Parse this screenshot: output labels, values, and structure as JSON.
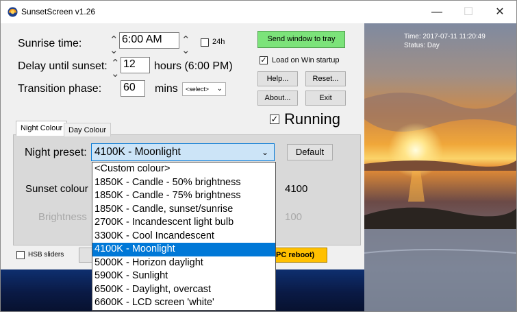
{
  "window": {
    "title": "SunsetScreen v1.26",
    "controls": {
      "minimize": "—",
      "maximize": "☐",
      "close": "✕"
    }
  },
  "sunrise": {
    "label": "Sunrise time:",
    "value": "6:00 AM",
    "h24_label": "24h"
  },
  "delay": {
    "label": "Delay until sunset:",
    "value": "12",
    "units": "hours (6:00 PM)"
  },
  "transition": {
    "label": "Transition phase:",
    "value": "60",
    "units": "mins",
    "select_value": "<select>"
  },
  "buttons": {
    "tray": "Send window to tray",
    "load_startup": "Load on Win startup",
    "help": "Help...",
    "reset": "Reset...",
    "about": "About...",
    "exit": "Exit",
    "running": "Running",
    "default": "Default"
  },
  "status": {
    "time": "Time: 2017-07-11 11:20:49",
    "state": "Status: Day"
  },
  "tabs": [
    "Night Colour",
    "Day Colour"
  ],
  "night": {
    "preset_label": "Night preset:",
    "preset_value": "4100K - Moonlight",
    "sunset_colour_label": "Sunset colour",
    "sunset_colour_value": "4100",
    "brightness_label": "Brightness",
    "brightness_value": "100"
  },
  "dropdown_options": [
    "<Custom colour>",
    "1850K - Candle - 50% brightness",
    "1850K - Candle - 75% brightness",
    "1850K - Candle, sunset/sunrise",
    "2700K - Incandescent light bulb",
    "3300K - Cool Incandescent",
    "4100K - Moonlight",
    "5000K - Horizon daylight",
    "5900K - Sunlight",
    "6500K - Daylight, overcast",
    "6600K - LCD screen 'white'"
  ],
  "selected_option_index": 6,
  "hsb_sliders_label": "HSB sliders",
  "pc_reboot_text": "PC reboot)",
  "colors": {
    "accent": "#0078d7",
    "tray_button": "#7ce37a",
    "reboot_button": "#ffc000"
  }
}
